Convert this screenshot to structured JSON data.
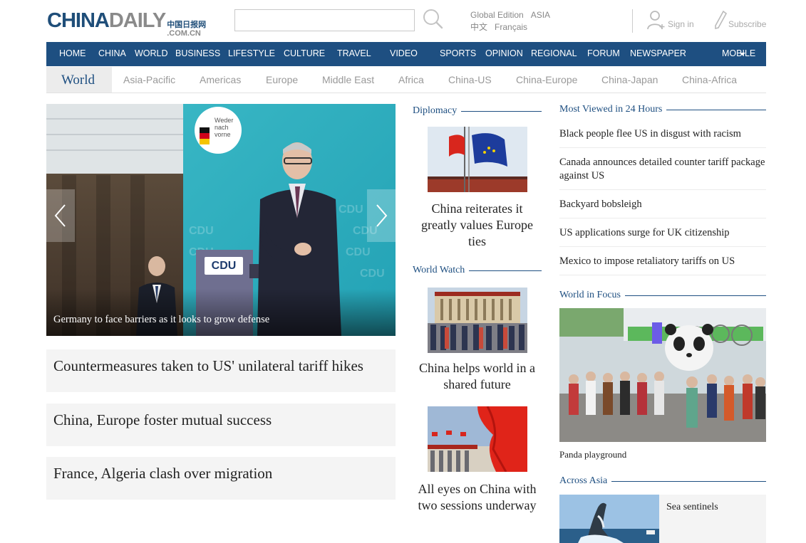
{
  "header": {
    "logo_main_1": "CHINA",
    "logo_main_2": "DAILY",
    "logo_cn": "中国日报网",
    "logo_com": ".COM.CN",
    "search_value": "",
    "editions_global": "Global Edition",
    "editions_asia": "ASIA",
    "editions_chinese": "中文",
    "editions_french": "Français",
    "signin_label": "Sign in",
    "subscribe_label": "Subscribe"
  },
  "mainnav": {
    "items": [
      "HOME",
      "CHINA",
      "WORLD",
      "BUSINESS",
      "LIFESTYLE",
      "CULTURE",
      "TRAVEL",
      "VIDEO",
      "SPORTS",
      "OPINION",
      "REGIONAL",
      "FORUM",
      "NEWSPAPER",
      "MOBILE"
    ]
  },
  "subnav": {
    "current": "World",
    "items": [
      "Asia-Pacific",
      "Americas",
      "Europe",
      "Middle East",
      "Africa",
      "China-US",
      "China-Europe",
      "China-Japan",
      "China-Africa"
    ]
  },
  "hero": {
    "caption": "Germany to face barriers as it looks to grow defense",
    "badge_text_1": "Weder",
    "badge_text_2": "nach",
    "badge_text_3": "vorne",
    "podium_sign": "CDU"
  },
  "left_stories": [
    "Countermeasures taken to US' unilateral tariff hikes",
    "China, Europe foster mutual success",
    "France, Algeria clash over migration"
  ],
  "middle": {
    "diplomacy_heading": "Diplomacy",
    "diplomacy_title": "China reiterates it greatly values Europe ties",
    "worldwatch_heading": "World Watch",
    "worldwatch_title_1": "China helps world in a shared future",
    "worldwatch_title_2": "All eyes on China with two sessions underway"
  },
  "right": {
    "mostviewed_heading": "Most Viewed in 24 Hours",
    "mostviewed": [
      "Black people flee US in disgust with racism",
      "Canada announces detailed counter tariff package against US",
      "Backyard bobsleigh",
      "US applications surge for UK citizenship",
      "Mexico to impose retaliatory tariffs on US"
    ],
    "focus_heading": "World in Focus",
    "focus_caption": "Panda playground",
    "asia_heading": "Across Asia",
    "asia_title": "Sea sentinels"
  },
  "colors": {
    "brand_blue": "#1e4f81",
    "nav_bg": "#1e4f81",
    "story_bg": "#f4f4f4"
  }
}
